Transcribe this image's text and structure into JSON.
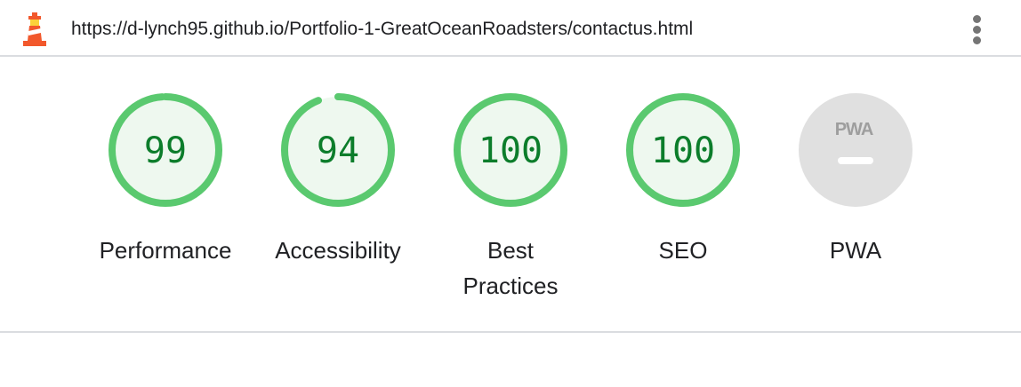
{
  "header": {
    "url": "https://d-lynch95.github.io/Portfolio-1-GreatOceanRoadsters/contactus.html",
    "logo_icon": "lighthouse-icon",
    "menu_icon": "more-vertical-icon"
  },
  "categories": [
    {
      "key": "performance",
      "score": "99",
      "fraction": 0.99,
      "label": "Performance"
    },
    {
      "key": "accessibility",
      "score": "94",
      "fraction": 0.94,
      "label": "Accessibility"
    },
    {
      "key": "best-practices",
      "score": "100",
      "fraction": 1.0,
      "label_line1": "Best",
      "label_line2": "Practices"
    },
    {
      "key": "seo",
      "score": "100",
      "fraction": 1.0,
      "label": "SEO"
    }
  ],
  "pwa": {
    "badge_text": "PWA",
    "label": "PWA"
  },
  "colors": {
    "pass_ring": "#5ac96f",
    "pass_fill": "#eef8ef",
    "pass_text": "#0c7d2b",
    "pwa_fill": "#e0e0e0",
    "pwa_text": "#9e9e9e",
    "logo": "#f2582c"
  }
}
